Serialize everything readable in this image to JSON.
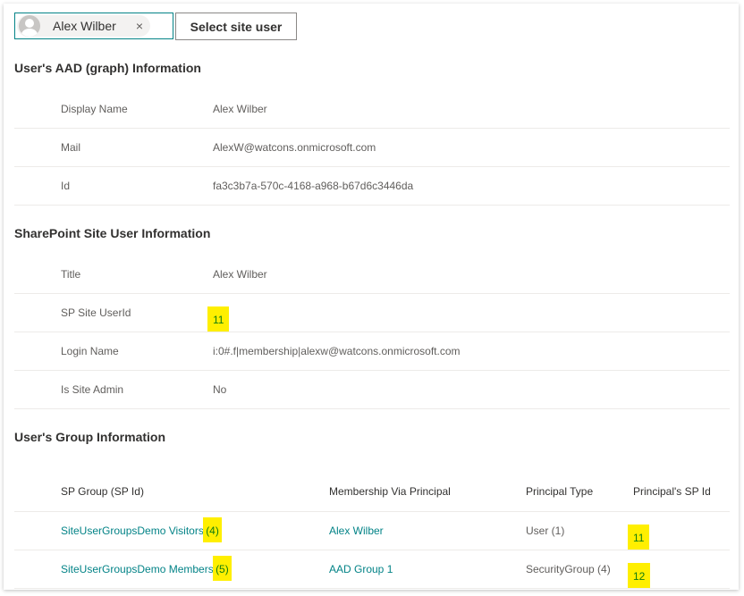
{
  "picker": {
    "selected_user": "Alex Wilber",
    "remove_icon": "×",
    "select_button": "Select site user"
  },
  "aad": {
    "title": "User's AAD (graph) Information",
    "rows": [
      {
        "label": "Display Name",
        "value": "Alex Wilber"
      },
      {
        "label": "Mail",
        "value": "AlexW@watcons.onmicrosoft.com"
      },
      {
        "label": "Id",
        "value": "fa3c3b7a-570c-4168-a968-b67d6c3446da"
      }
    ]
  },
  "sp": {
    "title": "SharePoint Site User Information",
    "rows": [
      {
        "label": "Title",
        "value": "Alex Wilber"
      },
      {
        "label": "SP Site UserId",
        "value": "11"
      },
      {
        "label": "Login Name",
        "value": "i:0#.f|membership|alexw@watcons.onmicrosoft.com"
      },
      {
        "label": "Is Site Admin",
        "value": "No"
      }
    ]
  },
  "groups": {
    "title": "User's Group Information",
    "headers": [
      "SP Group (SP Id)",
      "Membership Via Principal",
      "Principal Type",
      "Principal's SP Id"
    ],
    "rows": [
      {
        "group": "SiteUserGroupsDemo Visitors",
        "group_id": "(4)",
        "principal": "Alex Wilber",
        "type": "User (1)",
        "principal_id": "11"
      },
      {
        "group": "SiteUserGroupsDemo Members",
        "group_id": "(5)",
        "principal": "AAD Group 1",
        "type": "SecurityGroup (4)",
        "principal_id": "12"
      }
    ]
  },
  "colors": {
    "accent": "#038387",
    "highlight": "#ffef00"
  }
}
